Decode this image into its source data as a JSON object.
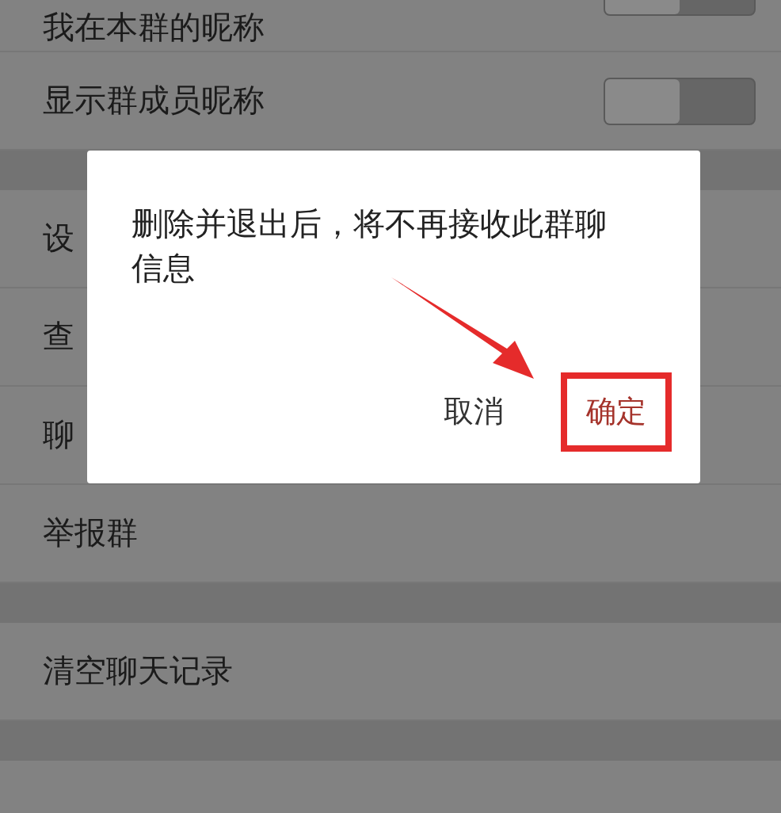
{
  "settings_rows": [
    {
      "label": "我在本群的昵称",
      "toggle": {
        "on": false
      }
    },
    {
      "label": "显示群成员昵称",
      "toggle": {
        "on": false
      },
      "gap_after": true
    },
    {
      "label": "设"
    },
    {
      "label": "查"
    },
    {
      "label": "聊"
    },
    {
      "label": "举报群",
      "gap_after": true
    },
    {
      "label": "清空聊天记录",
      "gap_after": true
    }
  ],
  "dialog": {
    "message": "删除并退出后，将不再接收此群聊信息",
    "buttons": [
      {
        "label": "取消",
        "highlighted": false,
        "kind": "cancel"
      },
      {
        "label": "确定",
        "highlighted": true,
        "kind": "confirm"
      }
    ]
  }
}
